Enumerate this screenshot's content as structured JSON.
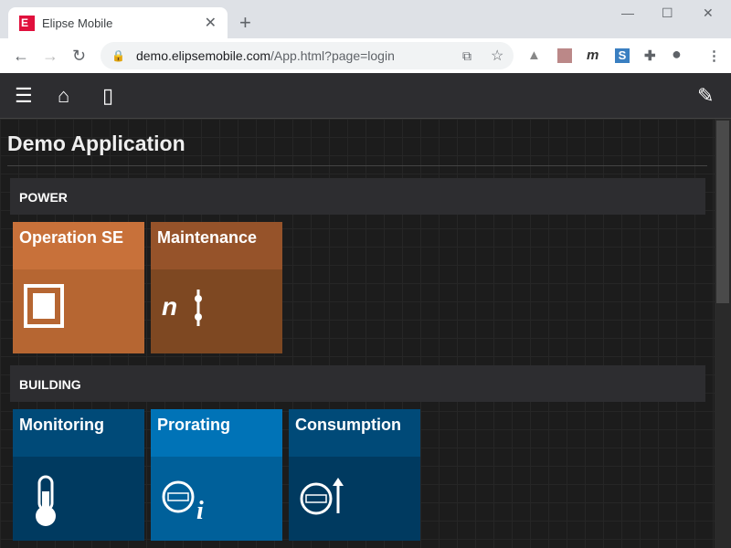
{
  "browser": {
    "tab_title": "Elipse Mobile",
    "favicon": "E",
    "url_host": "demo.elipsemobile.com",
    "url_path": "/App.html?page=login"
  },
  "app": {
    "title": "Demo Application"
  },
  "sections": [
    {
      "label": "POWER",
      "tiles": [
        {
          "label": "Operation SE",
          "icon": "breaker-square-icon",
          "header": "#c8713a",
          "body": "#b66632"
        },
        {
          "label": "Maintenance",
          "icon": "switch-n-icon",
          "header": "#96532a",
          "body": "#7e4822"
        }
      ]
    },
    {
      "label": "BUILDING",
      "tiles": [
        {
          "label": "Monitoring",
          "icon": "thermometer-icon",
          "header": "#004a78",
          "body": "#003a60"
        },
        {
          "label": "Prorating",
          "icon": "meter-info-icon",
          "header": "#0073b7",
          "body": "#00609a"
        },
        {
          "label": "Consumption",
          "icon": "meter-up-icon",
          "header": "#004a78",
          "body": "#003a60"
        }
      ]
    }
  ]
}
